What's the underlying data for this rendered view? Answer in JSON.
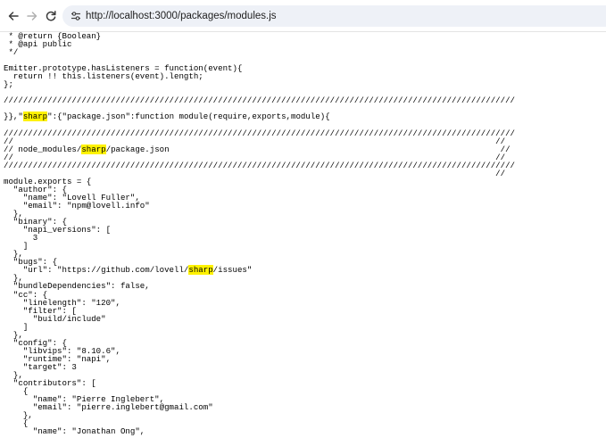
{
  "browser": {
    "url": "http://localhost:3000/packages/modules.js",
    "icons": [
      "back-arrow-icon",
      "forward-arrow-icon",
      "reload-icon",
      "site-info-tune-icon"
    ]
  },
  "colors": {
    "highlight": "#fff200",
    "omnibox": "#eef1f7"
  },
  "code": {
    "highlight_term": "sharp",
    "lines": [
      " * @return {Boolean}",
      " * @api public",
      " */",
      "",
      "Emitter.prototype.hasListeners = function(event){",
      "  return !! this.listeners(event).length;",
      "};",
      "",
      "/////////////////////////////////////////////////////////////////////////////////////////////////////////",
      "",
      "}},\"sharp\":{\"package.json\":function module(require,exports,module){",
      "",
      "/////////////////////////////////////////////////////////////////////////////////////////////////////////",
      "//                                                                                                   //",
      "// node_modules/sharp/package.json                                                                    //",
      "//                                                                                                   //",
      "/////////////////////////////////////////////////////////////////////////////////////////////////////////",
      "                                                                                                     //",
      "module.exports = {",
      "  \"author\": {",
      "    \"name\": \"Lovell Fuller\",",
      "    \"email\": \"npm@lovell.info\"",
      "  },",
      "  \"binary\": {",
      "    \"napi_versions\": [",
      "      3",
      "    ]",
      "  },",
      "  \"bugs\": {",
      "    \"url\": \"https://github.com/lovell/sharp/issues\"",
      "  },",
      "  \"bundleDependencies\": false,",
      "  \"cc\": {",
      "    \"linelength\": \"120\",",
      "    \"filter\": [",
      "      \"build/include\"",
      "    ]",
      "  },",
      "  \"config\": {",
      "    \"libvips\": \"8.10.6\",",
      "    \"runtime\": \"napi\",",
      "    \"target\": 3",
      "  },",
      "  \"contributors\": [",
      "    {",
      "      \"name\": \"Pierre Inglebert\",",
      "      \"email\": \"pierre.inglebert@gmail.com\"",
      "    },",
      "    {",
      "      \"name\": \"Jonathan Ong\","
    ]
  }
}
